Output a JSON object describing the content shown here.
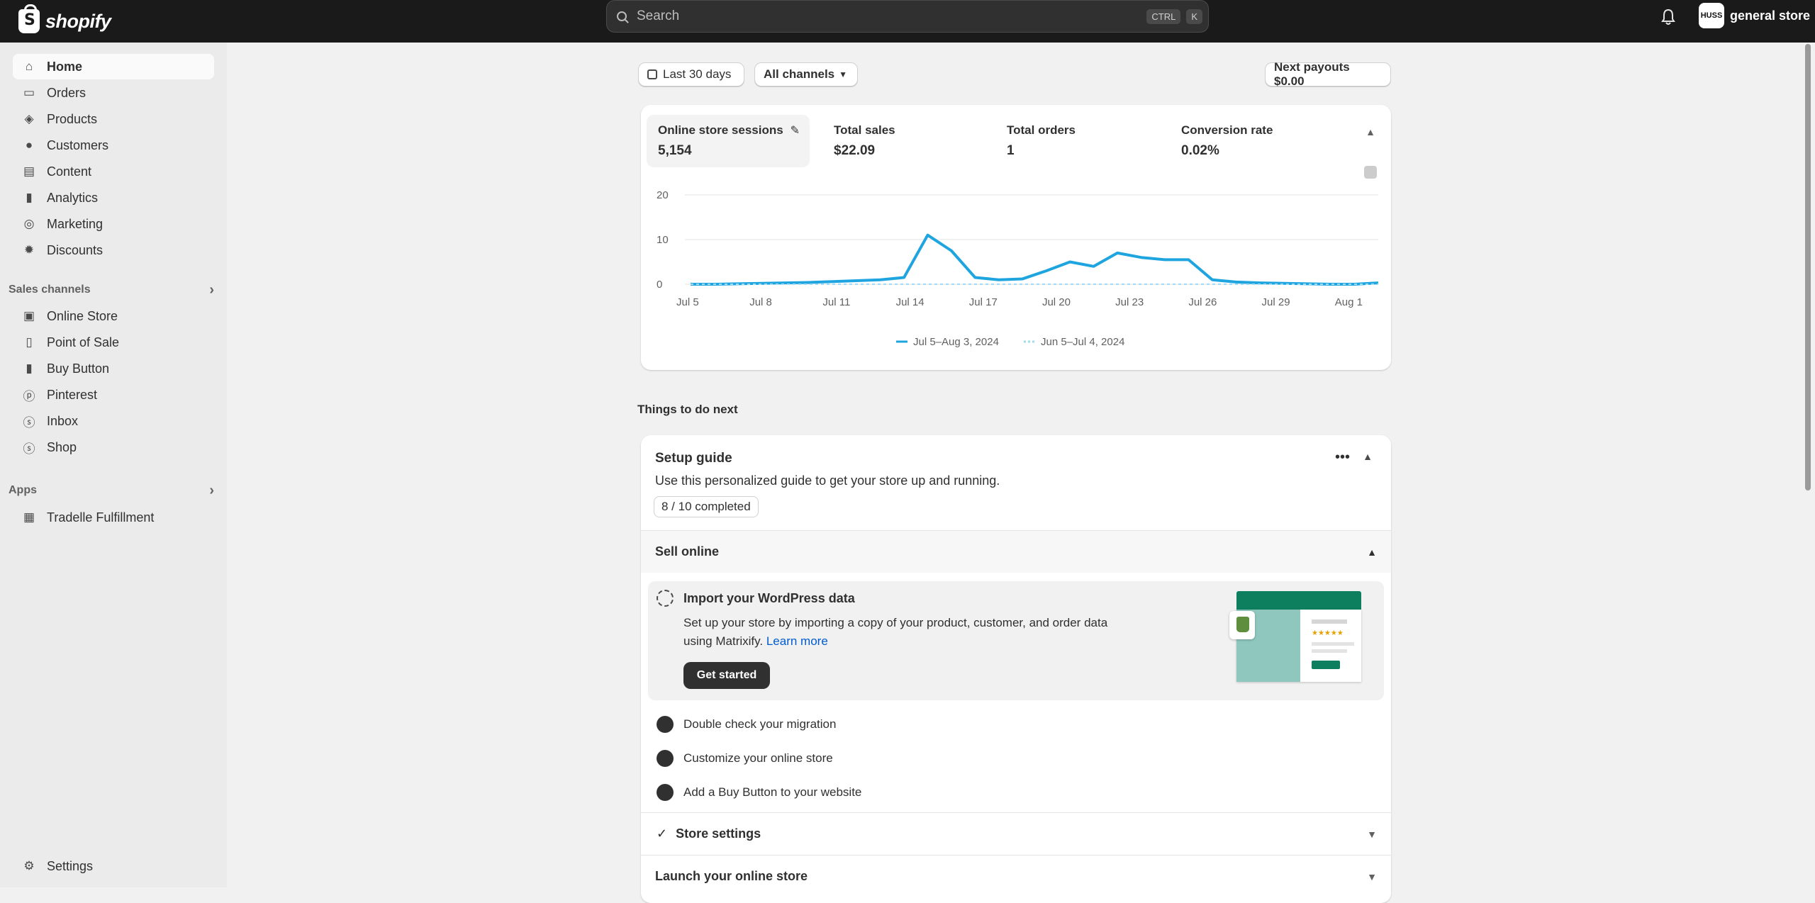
{
  "topbar": {
    "brand": "shopify",
    "search_placeholder": "Search",
    "shortcut_1": "CTRL",
    "shortcut_2": "K",
    "store_initials": "HUSS",
    "store_name": "general store"
  },
  "sidebar": {
    "items": [
      {
        "label": "Home",
        "icon": "home-icon",
        "glyph": "⌂"
      },
      {
        "label": "Orders",
        "icon": "inbox-icon",
        "glyph": "▭"
      },
      {
        "label": "Products",
        "icon": "tag-icon",
        "glyph": "◈"
      },
      {
        "label": "Customers",
        "icon": "person-icon",
        "glyph": "●"
      },
      {
        "label": "Content",
        "icon": "image-icon",
        "glyph": "▤"
      },
      {
        "label": "Analytics",
        "icon": "bar-chart-icon",
        "glyph": "▮"
      },
      {
        "label": "Marketing",
        "icon": "target-icon",
        "glyph": "◎"
      },
      {
        "label": "Discounts",
        "icon": "discount-icon",
        "glyph": "✹"
      }
    ],
    "sales_channels_label": "Sales channels",
    "channels": [
      {
        "label": "Online Store",
        "icon": "store-icon",
        "glyph": "▣"
      },
      {
        "label": "Point of Sale",
        "icon": "pos-icon",
        "glyph": "▯"
      },
      {
        "label": "Buy Button",
        "icon": "buy-button-icon",
        "glyph": "▮"
      },
      {
        "label": "Pinterest",
        "icon": "pinterest-icon",
        "glyph": "ⓟ"
      },
      {
        "label": "Inbox",
        "icon": "chat-icon",
        "glyph": "ⓢ"
      },
      {
        "label": "Shop",
        "icon": "shop-icon",
        "glyph": "ⓢ"
      }
    ],
    "apps_label": "Apps",
    "apps": [
      {
        "label": "Tradelle Fulfillment",
        "icon": "app-icon",
        "glyph": "▦"
      }
    ],
    "settings_label": "Settings"
  },
  "filters": {
    "date_range": "Last 30 days",
    "channel": "All channels",
    "payouts": "Next payouts $0.00"
  },
  "metrics": [
    {
      "label": "Online store sessions",
      "value": "5,154"
    },
    {
      "label": "Total sales",
      "value": "$22.09"
    },
    {
      "label": "Total orders",
      "value": "1"
    },
    {
      "label": "Conversion rate",
      "value": "0.02%"
    }
  ],
  "chart_data": {
    "type": "line",
    "y_ticks": [
      "20",
      "10",
      "0"
    ],
    "ylim": [
      0,
      20
    ],
    "categories": [
      "Jul 5",
      "Jul 8",
      "Jul 11",
      "Jul 14",
      "Jul 17",
      "Jul 20",
      "Jul 23",
      "Jul 26",
      "Jul 29",
      "Aug 1"
    ],
    "x": [
      0,
      1,
      2,
      3,
      4,
      5,
      6,
      7,
      8,
      9,
      10,
      11,
      12,
      13,
      14,
      15,
      16,
      17,
      18,
      19,
      20,
      21,
      22,
      23,
      24,
      25,
      26,
      27,
      28,
      29
    ],
    "series": [
      {
        "name": "Jul 5–Aug 3, 2024",
        "color": "#1ea5df",
        "values": [
          0,
          0,
          0.1,
          0.2,
          0.3,
          0.4,
          0.6,
          0.8,
          1,
          1.5,
          11,
          7.5,
          1.5,
          1,
          1.2,
          3,
          5,
          4,
          7,
          6,
          5.5,
          5.5,
          1,
          0.5,
          0.3,
          0.2,
          0.1,
          0,
          0,
          0.3
        ]
      },
      {
        "name": "Jun 5–Jul 4, 2024",
        "color": "#9fdcf3",
        "values": [
          0,
          0,
          0,
          0,
          0,
          0,
          0,
          0,
          0,
          0,
          0,
          0,
          0,
          0,
          0,
          0,
          0,
          0,
          0,
          0,
          0,
          0,
          0,
          0,
          0,
          0,
          0,
          0,
          0,
          0
        ]
      }
    ],
    "grid": true,
    "legend": "bottom"
  },
  "things_to_do": {
    "heading": "Things to do next",
    "setup_title": "Setup guide",
    "setup_desc": "Use this personalized guide to get your store up and running.",
    "progress": "8 / 10 completed",
    "sell_online": "Sell online",
    "active_task": {
      "title": "Import your WordPress data",
      "desc": "Set up your store by importing a copy of your product, customer, and order data using Matrixify.",
      "link": "Learn more",
      "button": "Get started"
    },
    "tasks": [
      "Double check your migration",
      "Customize your online store",
      "Add a Buy Button to your website"
    ],
    "store_settings": "Store settings",
    "launch": "Launch your online store"
  },
  "colors": {
    "topbar": "#1a1a1a",
    "accent": "#1ea5df",
    "link": "#005bd3",
    "illustration_green": "#0e7f5e"
  }
}
